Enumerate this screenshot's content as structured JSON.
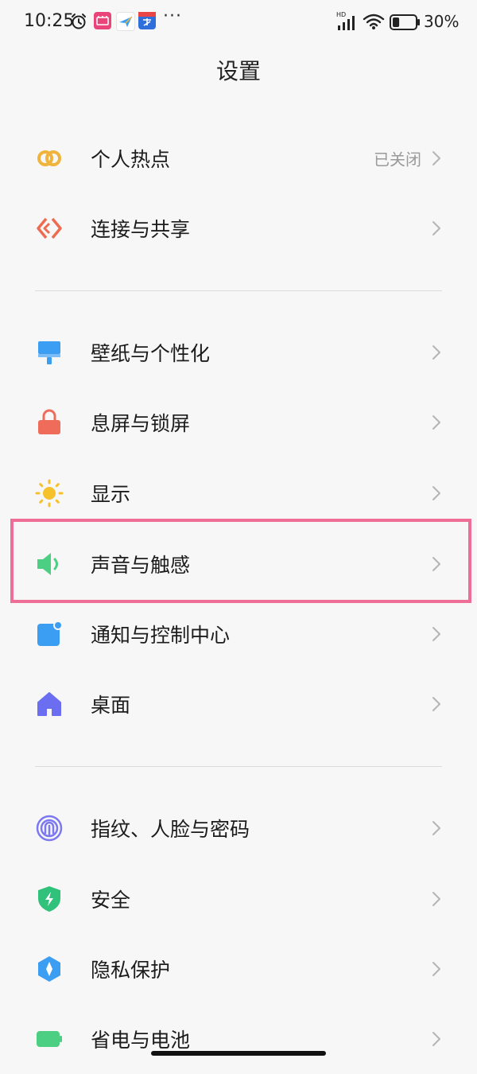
{
  "status_bar": {
    "time": "10:25",
    "network_badge": "HD",
    "battery_percent": "30%",
    "battery_level": 0.3,
    "overflow": "···"
  },
  "header": {
    "title": "设置"
  },
  "sections": [
    {
      "items": [
        {
          "label": "个人热点",
          "value": "已关闭",
          "icon": "hotspot-icon",
          "color": "#f0b43c"
        },
        {
          "label": "连接与共享",
          "value": "",
          "icon": "connection-share-icon",
          "color": "#ef6b50"
        }
      ]
    },
    {
      "items": [
        {
          "label": "壁纸与个性化",
          "value": "",
          "icon": "wallpaper-brush-icon",
          "color": "#3b9ef2"
        },
        {
          "label": "息屏与锁屏",
          "value": "",
          "icon": "lock-icon",
          "color": "#ef6b5a"
        },
        {
          "label": "显示",
          "value": "",
          "icon": "sun-icon",
          "color": "#f5c22b"
        },
        {
          "label": "声音与触感",
          "value": "",
          "icon": "speaker-icon",
          "color": "#4ccf82"
        },
        {
          "label": "通知与控制中心",
          "value": "",
          "icon": "notification-icon",
          "color": "#3b9ef2"
        },
        {
          "label": "桌面",
          "value": "",
          "icon": "home-icon",
          "color": "#6b6ef0"
        }
      ]
    },
    {
      "items": [
        {
          "label": "指纹、人脸与密码",
          "value": "",
          "icon": "fingerprint-icon",
          "color": "#7b78f0"
        },
        {
          "label": "安全",
          "value": "",
          "icon": "shield-bolt-icon",
          "color": "#30c17a"
        },
        {
          "label": "隐私保护",
          "value": "",
          "icon": "privacy-icon",
          "color": "#3b9ef2"
        },
        {
          "label": "省电与电池",
          "value": "",
          "icon": "battery-icon",
          "color": "#4ccf82"
        }
      ]
    }
  ],
  "highlighted_item": "声音与触感",
  "highlight_color": "#ee6e98"
}
